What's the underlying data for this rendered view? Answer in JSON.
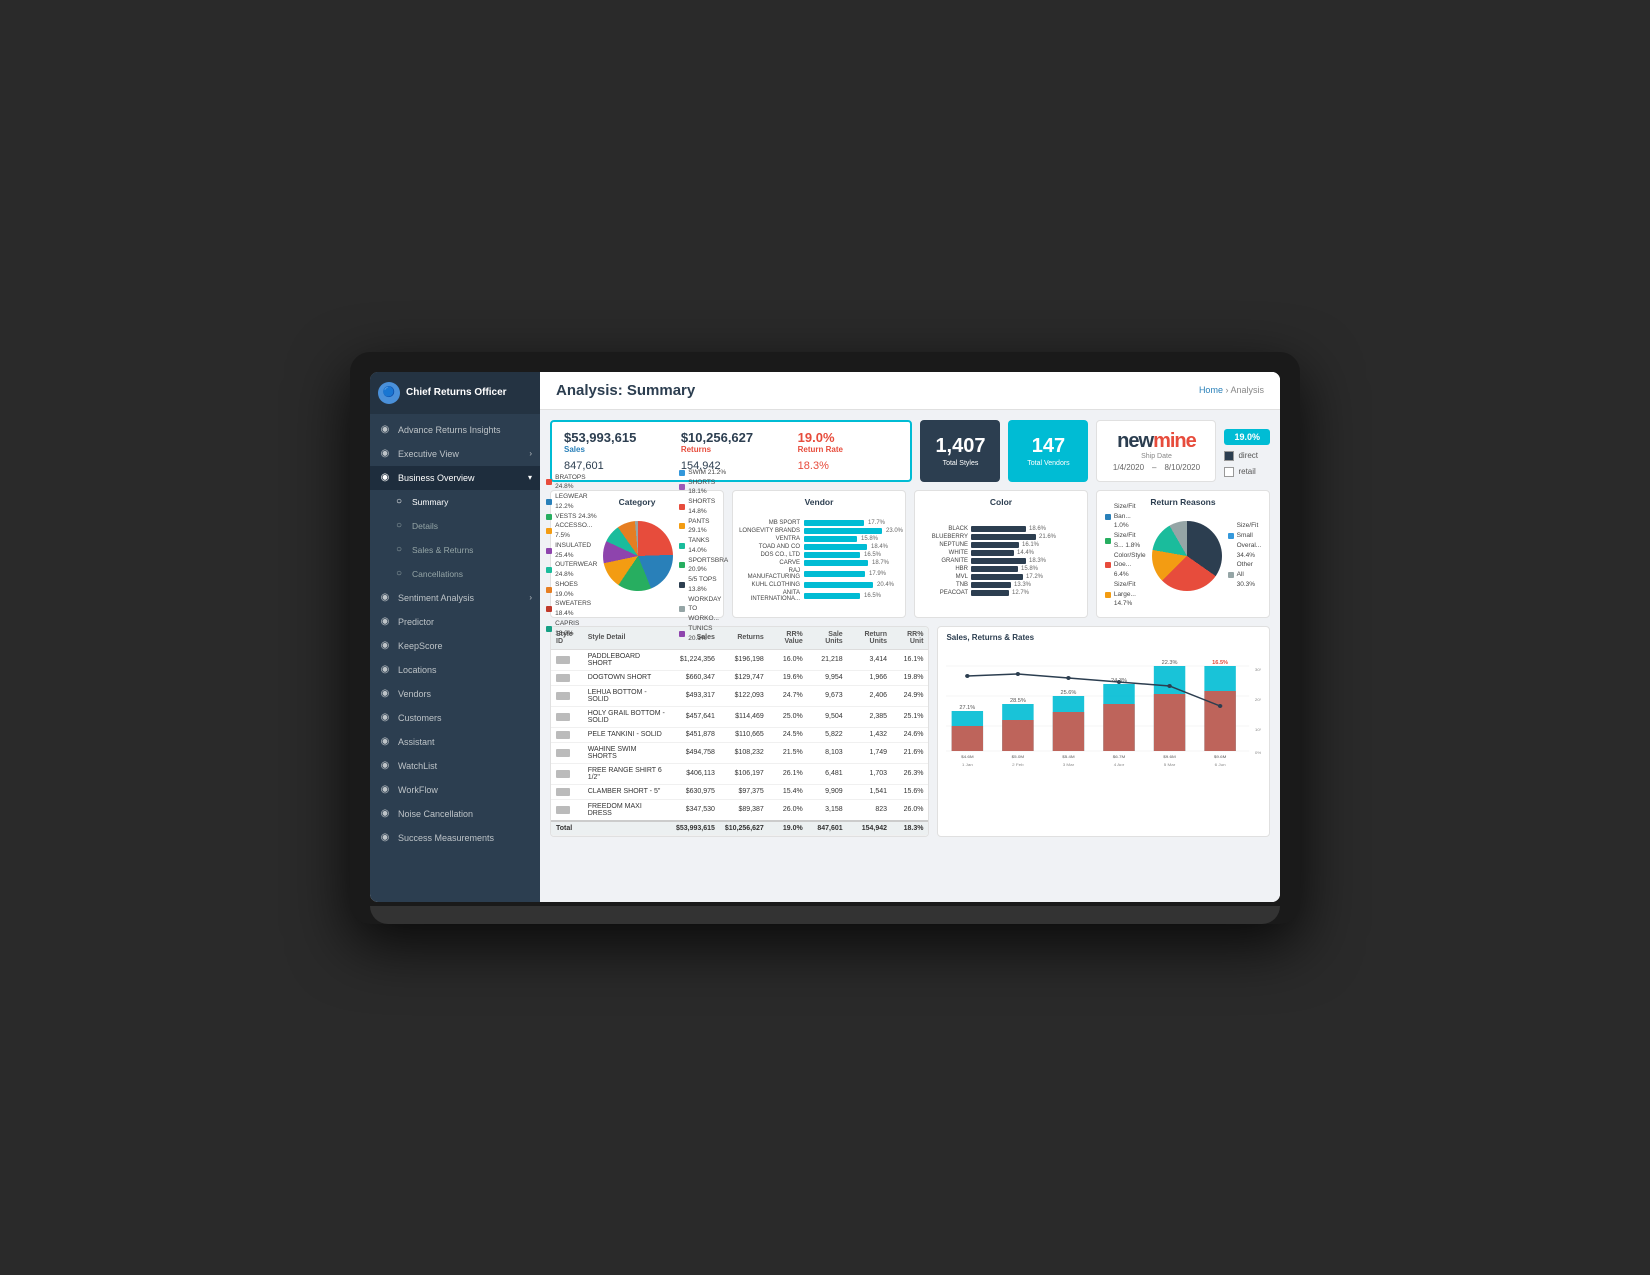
{
  "app": {
    "title": "Chief Returns Officer",
    "page_title": "Analysis: Summary"
  },
  "breadcrumb": {
    "home": "Home",
    "separator": "›",
    "current": "Analysis"
  },
  "sidebar": {
    "logo_text": "Chief Returns Officer",
    "items": [
      {
        "id": "advance-returns",
        "label": "Advance Returns Insights",
        "icon": "◉",
        "active": false
      },
      {
        "id": "executive-view",
        "label": "Executive View",
        "icon": "◉",
        "active": false,
        "arrow": "›"
      },
      {
        "id": "business-overview",
        "label": "Business Overview",
        "icon": "◉",
        "active": true,
        "arrow": "▾"
      },
      {
        "id": "summary",
        "label": "Summary",
        "sub": true,
        "active_sub": true
      },
      {
        "id": "details",
        "label": "Details",
        "sub": true
      },
      {
        "id": "sales-returns",
        "label": "Sales & Returns",
        "sub": true
      },
      {
        "id": "cancellations",
        "label": "Cancellations",
        "sub": true
      },
      {
        "id": "sentiment",
        "label": "Sentiment Analysis",
        "icon": "◉",
        "active": false,
        "arrow": "›"
      },
      {
        "id": "predictor",
        "label": "Predictor",
        "icon": "◉",
        "active": false
      },
      {
        "id": "keepscore",
        "label": "KeepScore",
        "icon": "◉",
        "active": false
      },
      {
        "id": "locations",
        "label": "Locations",
        "icon": "◉",
        "active": false
      },
      {
        "id": "vendors",
        "label": "Vendors",
        "icon": "◉",
        "active": false
      },
      {
        "id": "customers",
        "label": "Customers",
        "icon": "◉",
        "active": false
      },
      {
        "id": "assistant",
        "label": "Assistant",
        "icon": "◉",
        "active": false
      },
      {
        "id": "watchlist",
        "label": "WatchList",
        "icon": "◉",
        "active": false
      },
      {
        "id": "workflow",
        "label": "WorkFlow",
        "icon": "◉",
        "active": false
      },
      {
        "id": "noise-cancellation",
        "label": "Noise Cancellation",
        "icon": "◉",
        "active": false
      },
      {
        "id": "success-measurements",
        "label": "Success Measurements",
        "icon": "◉",
        "active": false
      }
    ]
  },
  "kpis": {
    "sales_value": "$53,993,615",
    "sales_label": "Sales",
    "sales_sub": "847,601",
    "returns_value": "$10,256,627",
    "returns_label": "Returns",
    "returns_sub": "154,942",
    "rate_value": "19.0%",
    "rate_label": "Return Rate",
    "rate_sub": "18.3%",
    "total_styles_value": "1,407",
    "total_styles_label": "Total Styles",
    "total_vendors_value": "147",
    "total_vendors_label": "Total Vendors",
    "rate_badge": "19.0%",
    "direct_label": "direct",
    "retail_label": "retail",
    "ship_date_label": "Ship Date",
    "date_start": "1/4/2020",
    "date_end": "8/10/2020"
  },
  "charts": {
    "category_title": "Category",
    "vendor_title": "Vendor",
    "color_title": "Color",
    "return_reasons_title": "Return Reasons",
    "category_items": [
      {
        "label": "BRATOPS 24.8%",
        "color": "#e74c3c"
      },
      {
        "label": "LEGWEAR 12.2%",
        "color": "#2980b9"
      },
      {
        "label": "VESTS 24.3%",
        "color": "#27ae60"
      },
      {
        "label": "ACCESSO... 7.5%",
        "color": "#f39c12"
      },
      {
        "label": "INSULATED 25.4%",
        "color": "#8e44ad"
      },
      {
        "label": "OUTERWEAR 24.8%",
        "color": "#1abc9c"
      },
      {
        "label": "SHOES 19.0%",
        "color": "#e67e22"
      },
      {
        "label": "SWEATERS 18.4%",
        "color": "#c0392b"
      },
      {
        "label": "CAPRIS 18.0%",
        "color": "#16a085"
      }
    ],
    "vendor_items": [
      {
        "label": "MB SPORT",
        "pct": 17.7,
        "pct_text": "17.7%"
      },
      {
        "label": "LONGEVITY BRANDS",
        "pct": 23.0,
        "pct_text": "23.0%"
      },
      {
        "label": "VENTRA",
        "pct": 15.8,
        "pct_text": "15.8%"
      },
      {
        "label": "TOAD AND CO",
        "pct": 18.4,
        "pct_text": "18.4%"
      },
      {
        "label": "DOS CO., LTD",
        "pct": 16.5,
        "pct_text": "16.5%"
      },
      {
        "label": "CARVE",
        "pct": 18.7,
        "pct_text": "18.7%"
      },
      {
        "label": "RAJ MANUFACTURING",
        "pct": 17.9,
        "pct_text": "17.9%"
      },
      {
        "label": "KUHL CLOTHING",
        "pct": 20.4,
        "pct_text": "20.4%"
      },
      {
        "label": "ANITA INTERNATIONA...",
        "pct": 16.5,
        "pct_text": "16.5%"
      }
    ],
    "color_items": [
      {
        "label": "BLACK",
        "pct": 37,
        "pct_text": "18.6%"
      },
      {
        "label": "BLUEBERRY",
        "pct": 43,
        "pct_text": "21.6%"
      },
      {
        "label": "NEPTUNE",
        "pct": 32,
        "pct_text": "16.1%"
      },
      {
        "label": "WHITE",
        "pct": 29,
        "pct_text": "14.4%"
      },
      {
        "label": "GRANITE",
        "pct": 36,
        "pct_text": "18.3%"
      },
      {
        "label": "HBR",
        "pct": 31,
        "pct_text": "15.8%"
      },
      {
        "label": "MVL",
        "pct": 34,
        "pct_text": "17.2%"
      },
      {
        "label": "TNB",
        "pct": 27,
        "pct_text": "13.3%"
      },
      {
        "label": "PEACOAT",
        "pct": 25,
        "pct_text": "12.7%"
      }
    ]
  },
  "table": {
    "columns": [
      "Style ID",
      "Style Detail",
      "Sales",
      "Returns",
      "RR% Value",
      "Sale Units",
      "Return Units",
      "RR% Unit"
    ],
    "rows": [
      {
        "id": "",
        "name": "PADDLEBOARD SHORT",
        "sales": "$1,224,356",
        "returns": "$196,198",
        "rr_val": "16.0%",
        "sale_units": "21,218",
        "return_units": "3,414",
        "rr_unit": "16.1%"
      },
      {
        "id": "",
        "name": "DOGTOWN SHORT",
        "sales": "$660,347",
        "returns": "$129,747",
        "rr_val": "19.6%",
        "sale_units": "9,954",
        "return_units": "1,966",
        "rr_unit": "19.8%"
      },
      {
        "id": "",
        "name": "LEHUA BOTTOM - SOLID",
        "sales": "$493,317",
        "returns": "$122,093",
        "rr_val": "24.7%",
        "sale_units": "9,673",
        "return_units": "2,406",
        "rr_unit": "24.9%"
      },
      {
        "id": "",
        "name": "HOLY GRAIL BOTTOM - SOLID",
        "sales": "$457,641",
        "returns": "$114,469",
        "rr_val": "25.0%",
        "sale_units": "9,504",
        "return_units": "2,385",
        "rr_unit": "25.1%"
      },
      {
        "id": "",
        "name": "PELE TANKINI - SOLID",
        "sales": "$451,878",
        "returns": "$110,665",
        "rr_val": "24.5%",
        "sale_units": "5,822",
        "return_units": "1,432",
        "rr_unit": "24.6%"
      },
      {
        "id": "",
        "name": "WAHINE SWIM SHORTS",
        "sales": "$494,758",
        "returns": "$108,232",
        "rr_val": "21.5%",
        "sale_units": "8,103",
        "return_units": "1,749",
        "rr_unit": "21.6%"
      },
      {
        "id": "",
        "name": "FREE RANGE SHIRT 6 1/2\"",
        "sales": "$406,113",
        "returns": "$106,197",
        "rr_val": "26.1%",
        "sale_units": "6,481",
        "return_units": "1,703",
        "rr_unit": "26.3%"
      },
      {
        "id": "",
        "name": "CLAMBER SHORT - 5\"",
        "sales": "$630,975",
        "returns": "$97,375",
        "rr_val": "15.4%",
        "sale_units": "9,909",
        "return_units": "1,541",
        "rr_unit": "15.6%"
      },
      {
        "id": "",
        "name": "FREEDOM MAXI DRESS",
        "sales": "$347,530",
        "returns": "$89,387",
        "rr_val": "26.0%",
        "sale_units": "3,158",
        "return_units": "823",
        "rr_unit": "26.0%"
      }
    ],
    "totals": {
      "sales": "$53,993,615",
      "returns": "$10,256,627",
      "rr_val": "19.0%",
      "sale_units": "847,601",
      "return_units": "154,942",
      "rr_unit": "18.3%"
    }
  },
  "sales_chart": {
    "title": "Sales, Returns & Rates",
    "bars": [
      {
        "label": "1 Jan 2020",
        "sales": 4618753,
        "returns": 1232062,
        "rate": 27.1
      },
      {
        "label": "2 Feb 2020",
        "sales": 5023624,
        "returns": 1431054,
        "rate": 28.5
      },
      {
        "label": "3 Mar 2020",
        "sales": 5362330,
        "returns": 1606500,
        "rate": 25.6
      },
      {
        "label": "4 Apr 2020",
        "sales": 6725305,
        "returns": 1827300,
        "rate": 24.3
      },
      {
        "label": "5 Mar 2020",
        "sales": 9563826,
        "returns": 2088950,
        "rate": 22.3
      },
      {
        "label": "6 Jun 2020",
        "sales": 9563826,
        "returns": 2165136,
        "rate": 16.5
      }
    ]
  }
}
